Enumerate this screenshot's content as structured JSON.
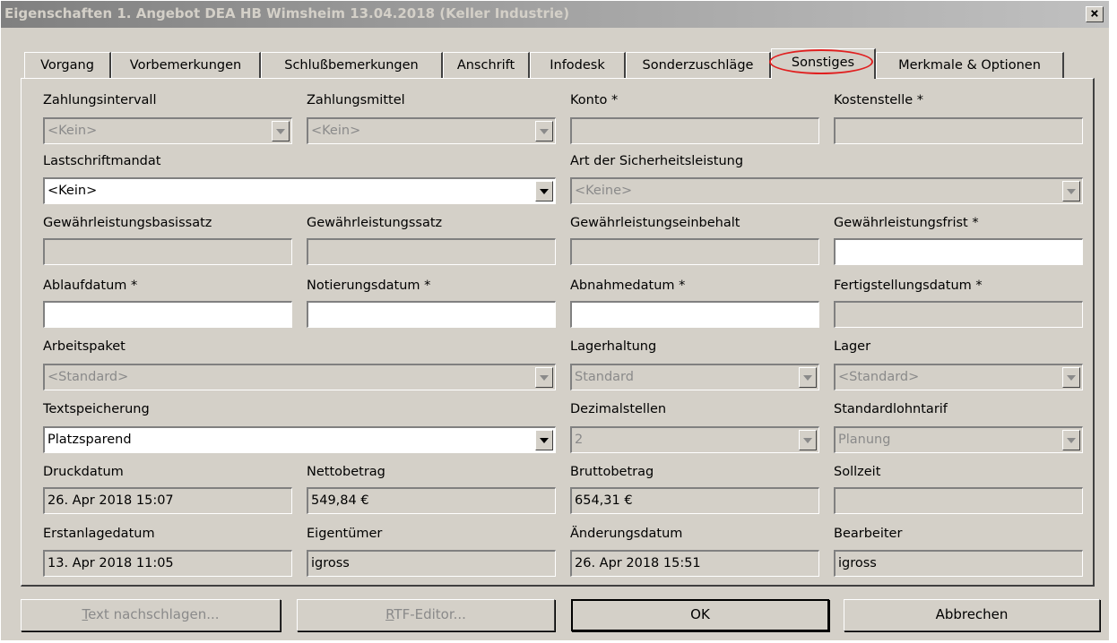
{
  "window": {
    "title": "Eigenschaften 1. Angebot DEA HB Wimsheim 13.04.2018 (Keller Industrie)",
    "close_glyph": "×"
  },
  "tabs": [
    {
      "label": "Vorgang"
    },
    {
      "label": "Vorbemerkungen"
    },
    {
      "label": "Schlußbemerkungen"
    },
    {
      "label": "Anschrift"
    },
    {
      "label": "Infodesk"
    },
    {
      "label": "Sonderzuschläge"
    },
    {
      "label": "Sonstiges",
      "active": true
    },
    {
      "label": "Merkmale & Optionen"
    }
  ],
  "form": {
    "zahlungsintervall": {
      "label": "Zahlungsintervall",
      "value": "<Kein>"
    },
    "zahlungsmittel": {
      "label": "Zahlungsmittel",
      "value": "<Kein>"
    },
    "konto": {
      "label": "Konto *",
      "value": ""
    },
    "kostenstelle": {
      "label": "Kostenstelle *",
      "value": ""
    },
    "lastschriftmandat": {
      "label": "Lastschriftmandat",
      "value": "<Kein>"
    },
    "sicherheitsleistung": {
      "label": "Art der Sicherheitsleistung",
      "value": "<Keine>"
    },
    "gew_basissatz": {
      "label": "Gewährleistungsbasissatz",
      "value": ""
    },
    "gew_satz": {
      "label": "Gewährleistungssatz",
      "value": ""
    },
    "gew_einbehalt": {
      "label": "Gewährleistungseinbehalt",
      "value": ""
    },
    "gew_frist": {
      "label": "Gewährleistungsfrist *",
      "value": ""
    },
    "ablaufdatum": {
      "label": "Ablaufdatum *",
      "value": ""
    },
    "notierungsdatum": {
      "label": "Notierungsdatum *",
      "value": ""
    },
    "abnahmedatum": {
      "label": "Abnahmedatum *",
      "value": ""
    },
    "fertigstellungsdatum": {
      "label": "Fertigstellungsdatum *",
      "value": ""
    },
    "arbeitspaket": {
      "label": "Arbeitspaket",
      "value": "<Standard>"
    },
    "lagerhaltung": {
      "label": "Lagerhaltung",
      "value": "Standard"
    },
    "lager": {
      "label": "Lager",
      "value": "<Standard>"
    },
    "textspeicherung": {
      "label": "Textspeicherung",
      "value": "Platzsparend"
    },
    "dezimalstellen": {
      "label": "Dezimalstellen",
      "value": "2"
    },
    "standardlohntarif": {
      "label": "Standardlohntarif",
      "value": "Planung"
    },
    "druckdatum": {
      "label": "Druckdatum",
      "value": "26. Apr 2018 15:07"
    },
    "nettobetrag": {
      "label": "Nettobetrag",
      "value": "549,84 €"
    },
    "bruttobetrag": {
      "label": "Bruttobetrag",
      "value": "654,31 €"
    },
    "sollzeit": {
      "label": "Sollzeit",
      "value": ""
    },
    "erstanlagedatum": {
      "label": "Erstanlagedatum",
      "value": "13. Apr 2018 11:05"
    },
    "eigentuemer": {
      "label": "Eigentümer",
      "value": "igross"
    },
    "aenderungsdatum": {
      "label": "Änderungsdatum",
      "value": "26. Apr 2018 15:51"
    },
    "bearbeiter": {
      "label": "Bearbeiter",
      "value": "igross"
    }
  },
  "buttons": {
    "text_nachschlagen": {
      "mnemonic": "T",
      "rest": "ext nachschlagen..."
    },
    "rtf_editor": {
      "mnemonic": "R",
      "rest": "TF-Editor..."
    },
    "ok": "OK",
    "abbrechen": "Abbrechen"
  }
}
